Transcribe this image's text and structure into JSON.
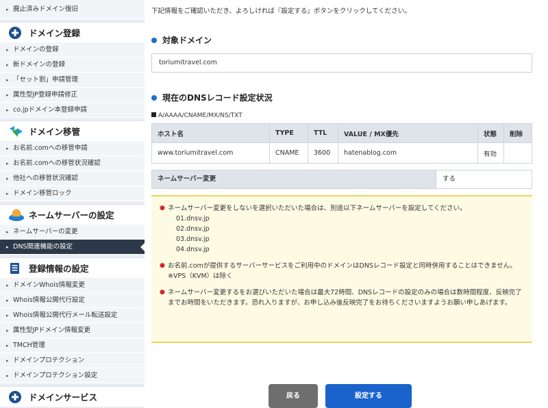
{
  "sidebar": {
    "first_item": "廃止済みドメイン復旧",
    "sections": [
      {
        "title": "ドメイン登録",
        "icon": "plus-circle-icon",
        "items": [
          "ドメインの登録",
          "新ドメインの登録",
          "「セット割」申請管理",
          "属性型JP登録申請修正",
          "co.jpドメイン本登録申請"
        ]
      },
      {
        "title": "ドメイン移管",
        "icon": "transfer-arrow-icon",
        "items": [
          "お名前.comへの移管申請",
          "お名前.comへの移管状況確認",
          "他社への移管状況確認",
          "ドメイン移管ロック"
        ]
      },
      {
        "title": "ネームサーバーの設定",
        "icon": "globe-icon",
        "items": [
          "ネームサーバーの変更",
          "DNS関連機能の設定"
        ]
      },
      {
        "title": "登録情報の設定",
        "icon": "document-icon",
        "items": [
          "ドメインWhois情報変更",
          "Whois情報公開代行設定",
          "Whois情報公開代行メール転送設定",
          "属性型JPドメイン情報変更",
          "TMCH管理",
          "ドメインプロテクション",
          "ドメインプロテクション設定"
        ]
      },
      {
        "title": "ドメインサービス",
        "icon": "plus-circle-icon",
        "items": []
      }
    ],
    "active_item": "DNS関連機能の設定"
  },
  "main": {
    "intro": "下記情報をご確認いただき、よろしければ『設定する』ボタンをクリックしてください。",
    "target_domain_title": "対象ドメイン",
    "target_domain_value": "toriumitravel.com",
    "dns_status_title": "現在のDNSレコード設定状況",
    "record_types": "A/AAAA/CNAME/MX/NS/TXT",
    "table": {
      "headers": [
        "ホスト名",
        "TYPE",
        "TTL",
        "VALUE / MX優先",
        "状態",
        "削除"
      ],
      "rows": [
        [
          "www.toriumitravel.com",
          "CNAME",
          "3600",
          "hatenablog.com",
          "有効",
          ""
        ]
      ]
    },
    "nameserver_change_label": "ネームサーバー変更",
    "nameserver_change_value": "する",
    "notices": {
      "n1": "ネームサーバー変更をしないを選択いただいた場合は、別途以下ネームサーバーを設定してください。",
      "nameservers": [
        "01.dnsv.jp",
        "02.dnsv.jp",
        "03.dnsv.jp",
        "04.dnsv.jp"
      ],
      "n2a": "お名前.comが提供するサーバーサービスをご利用中のドメインはDNSレコード設定と同時併用することはできません。",
      "n2b": "※VPS（KVM）は除く",
      "n3": "ネームサーバー変更するをお選びいただいた場合は最大72時間、DNSレコードの設定のみの場合は数時間程度、反映完了までお時間をいただきます。恐れ入りますが、お申し込み後反映完了をお待ちくださいますようお願い申しあげます。"
    },
    "buttons": {
      "back": "戻る",
      "submit": "設定する"
    }
  },
  "colors": {
    "accent_blue": "#1a63cc",
    "sidebar_active": "#2d3848",
    "notice_bg": "#fefbe4",
    "notice_border": "#f2d255",
    "notice_bullet": "#d9242b"
  }
}
